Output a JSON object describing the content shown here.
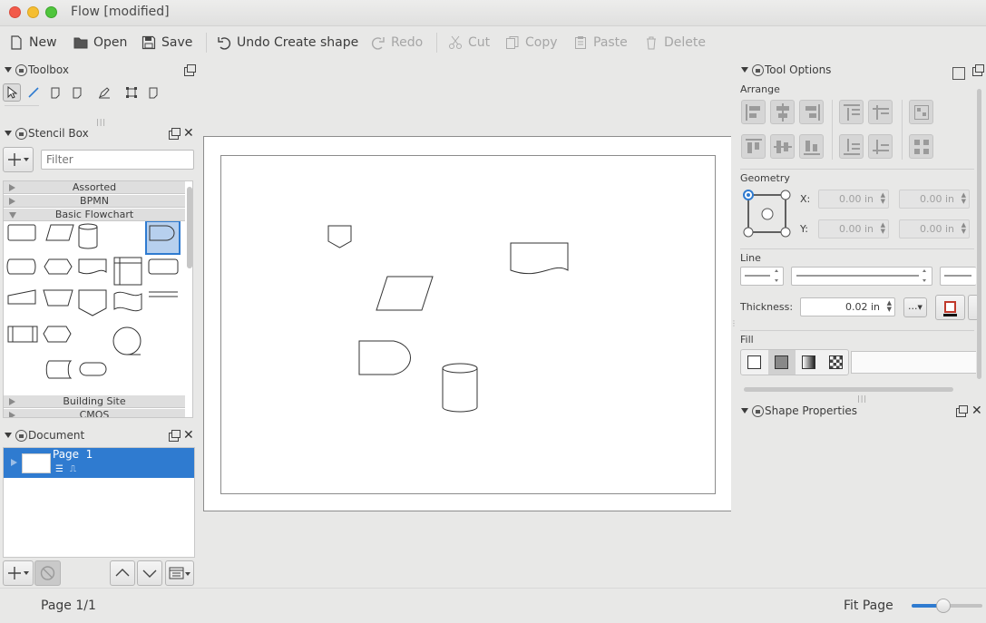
{
  "window": {
    "title": "Flow [modified]"
  },
  "toolbar": {
    "new": "New",
    "open": "Open",
    "save": "Save",
    "undo": "Undo Create shape",
    "redo": "Redo",
    "cut": "Cut",
    "copy": "Copy",
    "paste": "Paste",
    "delete": "Delete"
  },
  "toolbox": {
    "title": "Toolbox"
  },
  "stencil_box": {
    "title": "Stencil Box",
    "filter_placeholder": "Filter",
    "categories": [
      "Assorted",
      "BPMN",
      "Basic Flowchart",
      "Building Site",
      "CMOS"
    ]
  },
  "document": {
    "title": "Document",
    "page_name": "Page  1"
  },
  "tool_options": {
    "title": "Tool Options",
    "arrange_label": "Arrange",
    "geometry_label": "Geometry",
    "x_label": "X:",
    "y_label": "Y:",
    "x_value": "0.00 in",
    "x_value2": "0.00 in",
    "y_value": "0.00 in",
    "y_value2": "0.00 in",
    "line_label": "Line",
    "thickness_label": "Thickness:",
    "thickness_value": "0.02 in",
    "more_label": "...",
    "fill_label": "Fill"
  },
  "shape_properties": {
    "title": "Shape Properties"
  },
  "status": {
    "page": "Page 1/1",
    "zoom_mode": "Fit Page",
    "zoom_level": 0.43
  },
  "colors": {
    "selection": "#2f7bd0",
    "line_color": "#c0392b"
  }
}
